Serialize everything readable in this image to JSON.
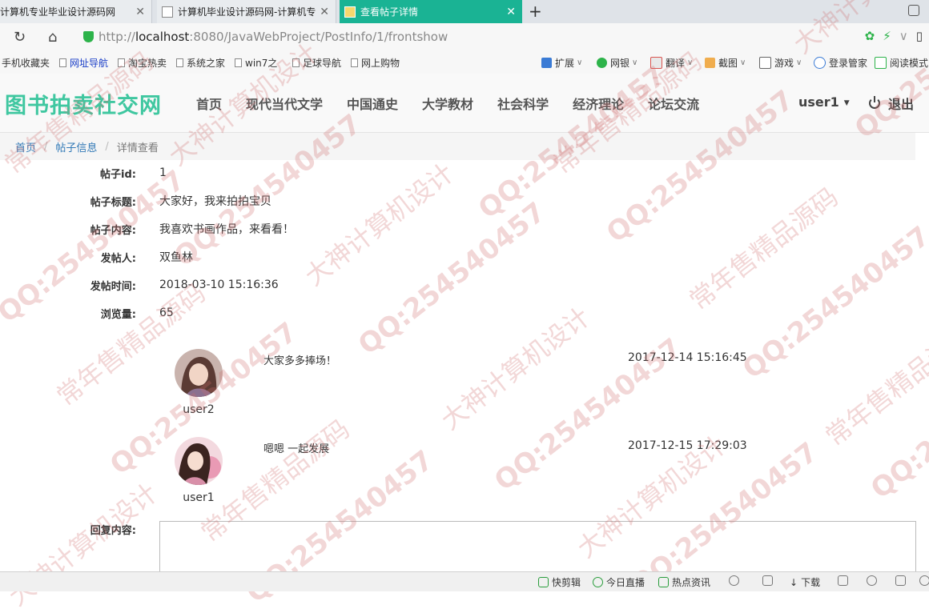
{
  "browser": {
    "tabs": [
      {
        "title": "计算机专业毕业设计源码网"
      },
      {
        "title": "计算机毕业设计源码网-计算机专"
      },
      {
        "title": "查看帖子详情"
      }
    ],
    "new_tab": "+",
    "url_gray_prefix": "http://",
    "url_host": "localhost",
    "url_rest": ":8080/JavaWebProject/PostInfo/1/frontshow",
    "bookmarks": [
      "手机收藏夹",
      "网址导航",
      "淘宝热卖",
      "系统之家",
      "win7之",
      "足球导航",
      "网上购物"
    ],
    "extensions": [
      "扩展",
      "网银",
      "翻译",
      "截图",
      "游戏",
      "登录管家",
      "阅读模式"
    ]
  },
  "site": {
    "logo": "图书拍卖社交网",
    "logo_color": "#3fc7a0",
    "nav": [
      "首页",
      "现代当代文学",
      "中国通史",
      "大学教材",
      "社会科学",
      "经济理论",
      "论坛交流"
    ],
    "username": "user1",
    "logout": "退出"
  },
  "breadcrumb": {
    "home": "首页",
    "section": "帖子信息",
    "current": "详情查看"
  },
  "post": {
    "fields": [
      {
        "label": "帖子id:",
        "value": "1"
      },
      {
        "label": "帖子标题:",
        "value": "大家好，我来拍拍宝贝"
      },
      {
        "label": "帖子内容:",
        "value": "我喜欢书画作品，来看看！"
      },
      {
        "label": "发帖人:",
        "value": "双鱼林"
      },
      {
        "label": "发帖时间:",
        "value": "2018-03-10 15:16:36"
      },
      {
        "label": "浏览量:",
        "value": "65"
      }
    ]
  },
  "replies": [
    {
      "user": "user2",
      "content": "大家多多捧场！",
      "time": "2017-12-14 15:16:45"
    },
    {
      "user": "user1",
      "content": "嗯嗯 一起发展",
      "time": "2017-12-15 17:29:03"
    }
  ],
  "reply_form": {
    "label": "回复内容:"
  },
  "statusbar": [
    "快剪辑",
    "今日直播",
    "热点资讯",
    "下载"
  ],
  "watermark": [
    "QQ:254540457",
    "大神计算机设计",
    "常年售精品源码"
  ]
}
